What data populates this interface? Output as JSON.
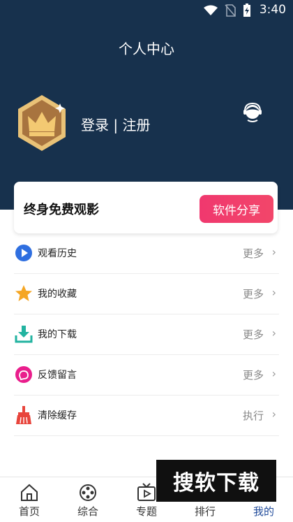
{
  "status_bar": {
    "time": "3:40"
  },
  "header": {
    "title": "个人中心",
    "login_label": "登录 | 注册"
  },
  "promo": {
    "text": "终身免费观影",
    "button": "软件分享"
  },
  "menu": [
    {
      "label": "观看历史",
      "action": "更多",
      "icon": "play-circle-icon"
    },
    {
      "label": "我的收藏",
      "action": "更多",
      "icon": "star-icon"
    },
    {
      "label": "我的下载",
      "action": "更多",
      "icon": "download-icon"
    },
    {
      "label": "反馈留言",
      "action": "更多",
      "icon": "feedback-icon"
    },
    {
      "label": "清除缓存",
      "action": "执行",
      "icon": "broom-icon"
    }
  ],
  "nav": [
    {
      "label": "首页",
      "icon": "home-icon"
    },
    {
      "label": "综合",
      "icon": "film-reel-icon"
    },
    {
      "label": "专题",
      "icon": "tv-icon"
    },
    {
      "label": "排行",
      "icon": "ranking-icon"
    },
    {
      "label": "我的",
      "icon": "profile-icon",
      "active": true
    }
  ],
  "watermark": "搜软下载",
  "colors": {
    "header_bg": "#17314d",
    "accent": "#f0386e",
    "nav_active": "#1f4a9a"
  }
}
